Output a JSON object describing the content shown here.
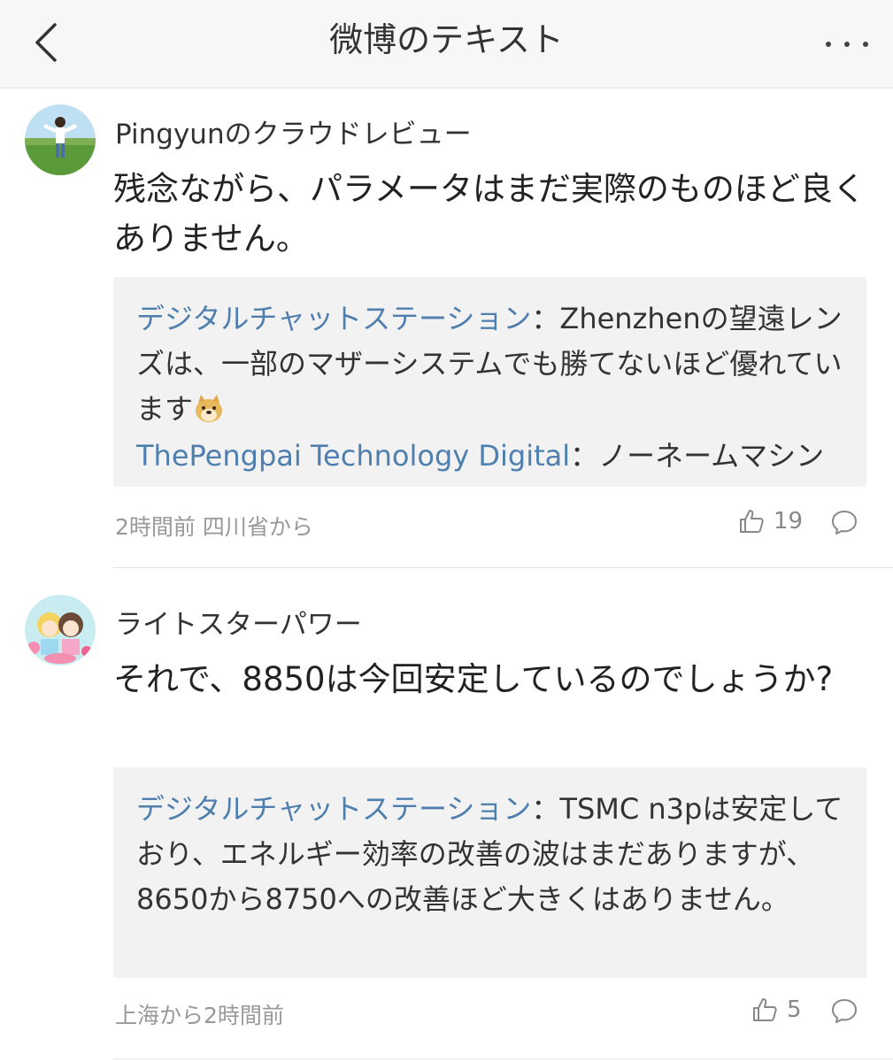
{
  "header": {
    "title": "微博のテキスト"
  },
  "comments": [
    {
      "username": "Pingyunのクラウドレビュー",
      "text": "残念ながら、パラメータはまだ実際のものほど良くありません。",
      "replies": [
        {
          "name": "デジタルチャットステーション",
          "text": "：Zhenzhenの望遠レンズは、一部のマザーシステムでも勝てないほど優れています",
          "emoji": "doge-emoji"
        },
        {
          "name": "ThePengpai Technology Digital",
          "text": "：ノーネームマシン"
        }
      ],
      "meta": "2時間前 四川省から",
      "likes": "19"
    },
    {
      "username": "ライトスターパワー",
      "text": "それで、8850は今回安定しているのでしょうか?",
      "replies": [
        {
          "name": "デジタルチャットステーション",
          "text": "：TSMC n3pは安定しており、エネルギー効率の改善の波はまだありますが、8650から8750への改善ほど大きくはありません。"
        }
      ],
      "meta": "上海から2時間前",
      "likes": "5"
    }
  ],
  "icons": {
    "back": "chevron-left-icon",
    "more": "more-dots-icon",
    "like": "thumbs-up-icon",
    "reply": "speech-bubble-icon"
  },
  "colors": {
    "link": "#4f7fae",
    "header_bg": "#f7f7f7",
    "reply_bg": "#f2f2f2"
  }
}
